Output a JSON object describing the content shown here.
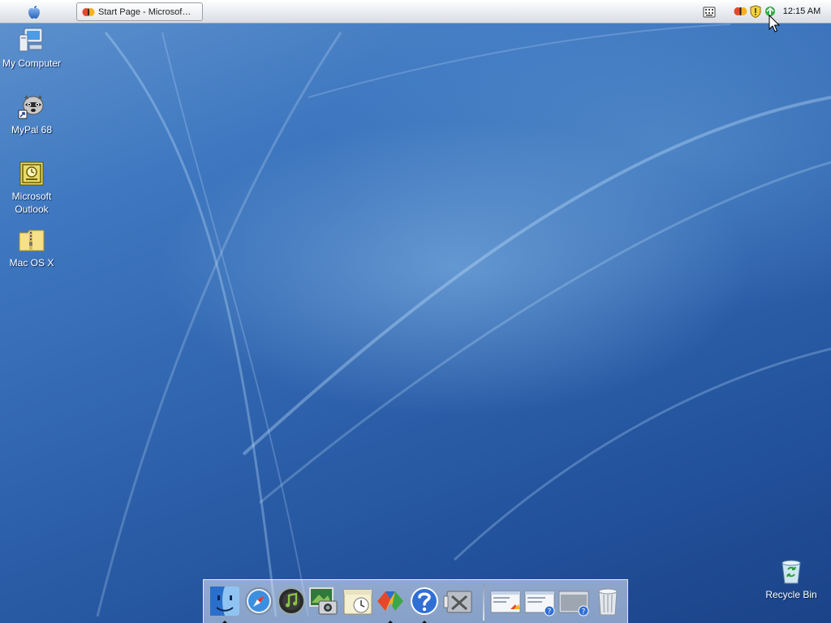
{
  "menubar": {
    "apple_menu_icon": "apple-logo-icon",
    "task_title": "Start Page - Microsof…",
    "task_icon": "browser-butterfly-icon",
    "tray_icons": [
      "keyboard-icon",
      "butterfly-tray-icon",
      "security-shield-icon",
      "network-tray-icon"
    ],
    "clock": "12:15 AM"
  },
  "desktop_icons": [
    {
      "label": "My Computer",
      "icon": "computer-icon"
    },
    {
      "label": "MyPal 68",
      "icon": "raccoon-icon"
    },
    {
      "label": "Microsoft Outlook",
      "icon": "outlook-icon"
    },
    {
      "label": "Mac OS X",
      "icon": "zip-folder-icon"
    },
    {
      "label": "Recycle Bin",
      "icon": "recycle-bin-icon"
    }
  ],
  "dock": {
    "apps": [
      "finder-icon",
      "safari-icon",
      "itunes-icon",
      "iphoto-icon",
      "ical-icon",
      "butterfly-browser-icon",
      "help-icon",
      "system-utilities-icon"
    ],
    "minimized_windows": [
      "window-thumbnail-icon",
      "window-thumbnail-help-icon",
      "window-thumbnail-help-icon"
    ],
    "trash": "trash-icon"
  },
  "colors": {
    "desktop_blue": "#2e62ac",
    "menubar_bg": "#eceff3",
    "label_text": "#ffffff"
  }
}
